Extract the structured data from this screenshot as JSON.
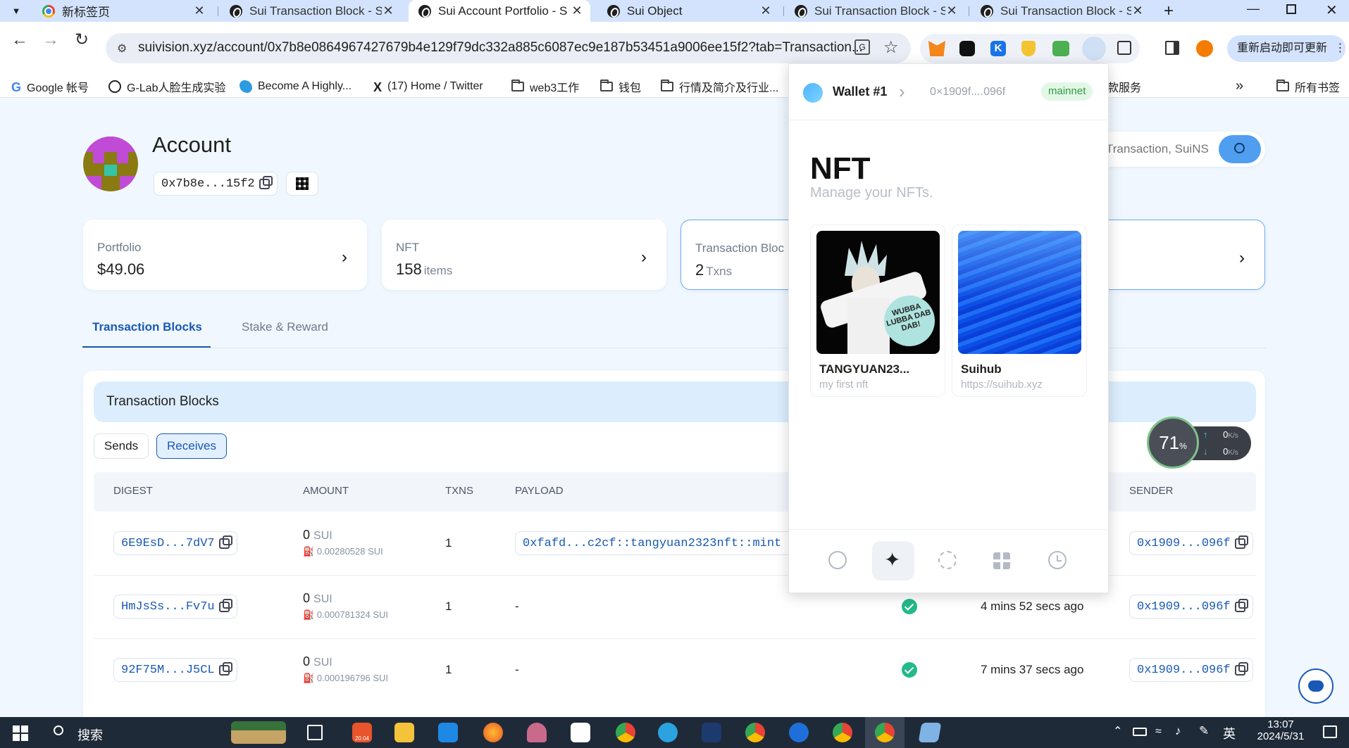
{
  "tabs": [
    {
      "label": "新标签页",
      "icon": "chrome"
    },
    {
      "label": "Sui Transaction Block - S",
      "icon": "sui"
    },
    {
      "label": "Sui Account Portfolio - S",
      "icon": "sui"
    },
    {
      "label": "Sui Object",
      "icon": "sui"
    },
    {
      "label": "Sui Transaction Block - S",
      "icon": "sui"
    },
    {
      "label": "Sui Transaction Block - S",
      "icon": "sui"
    }
  ],
  "omnibox": {
    "url": "suivision.xyz/account/0x7b8e0864967427679b4e129f79dc332a885c6087ec9e187b53451a9006ee15f2?tab=Transaction..."
  },
  "toolbar": {
    "relaunch_label": "重新启动即可更新"
  },
  "bookmarks": [
    {
      "label": "Google 帐号"
    },
    {
      "label": "G-Lab人脸生成实验"
    },
    {
      "label": "Become A Highly..."
    },
    {
      "label": "(17) Home / Twitter"
    },
    {
      "label": "web3工作"
    },
    {
      "label": "钱包"
    },
    {
      "label": "行情及简介及行业..."
    },
    {
      "label": "款服务"
    },
    {
      "label": "所有书签"
    }
  ],
  "account": {
    "title": "Account",
    "address_short": "0x7b8e...15f2"
  },
  "search": {
    "placeholder": "Transaction, SuiNS"
  },
  "cards": {
    "portfolio": {
      "label": "Portfolio",
      "value": "$49.06"
    },
    "nft": {
      "label": "NFT",
      "value": "158",
      "unit": "items"
    },
    "txblocks": {
      "label": "Transaction Bloc",
      "value": "2",
      "unit": "Txns"
    }
  },
  "page_tabs": {
    "tx_blocks": "Transaction Blocks",
    "stake": "Stake & Reward"
  },
  "table": {
    "title": "Transaction Blocks",
    "filters": {
      "sends": "Sends",
      "receives": "Receives"
    },
    "headers": {
      "digest": "DIGEST",
      "amount": "AMOUNT",
      "txns": "TXNS",
      "payload": "PAYLOAD",
      "sender": "SENDER"
    },
    "rows": [
      {
        "digest": "6E9EsD...7dV7",
        "amount": "0",
        "unit": "SUI",
        "gas": "0.00280528 SUI",
        "txns": "1",
        "payload": "0xfafd...c2cf::tangyuan2323nft::mint",
        "time": "",
        "sender": "0x1909...096f"
      },
      {
        "digest": "HmJsSs...Fv7u",
        "amount": "0",
        "unit": "SUI",
        "gas": "0.000781324 SUI",
        "txns": "1",
        "payload": "-",
        "time": "4 mins 52 secs ago",
        "sender": "0x1909...096f"
      },
      {
        "digest": "92F75M...J5CL",
        "amount": "0",
        "unit": "SUI",
        "gas": "0.000196796 SUI",
        "txns": "1",
        "payload": "-",
        "time": "7 mins 37 secs ago",
        "sender": "0x1909...096f"
      }
    ]
  },
  "speed_widget": {
    "percent": "71",
    "percent_sign": "%",
    "up": "0",
    "down": "0",
    "unit": "K/s"
  },
  "wallet": {
    "name": "Wallet #1",
    "address": "0×1909f....096f",
    "network": "mainnet",
    "heading": "NFT",
    "subheading": "Manage your NFTs.",
    "nfts": [
      {
        "name": "TANGYUAN23...",
        "desc": "my first nft",
        "art_text": "WUBBA LUBBA DAB DAB!"
      },
      {
        "name": "Suihub",
        "desc": "https://suihub.xyz"
      }
    ],
    "nav": [
      "coins-icon",
      "nft-sparkle-icon",
      "swap-icon",
      "apps-grid-icon",
      "history-icon"
    ]
  },
  "taskbar": {
    "search_label": "搜索",
    "calendar_badge": "20.04",
    "lang": "英",
    "time": "13:07",
    "date": "2024/5/31"
  },
  "colors": {
    "accent": "#1959b5",
    "page_bg": "#f0f7ff",
    "success": "#23b98a",
    "network_bg": "#e3f7e6"
  }
}
